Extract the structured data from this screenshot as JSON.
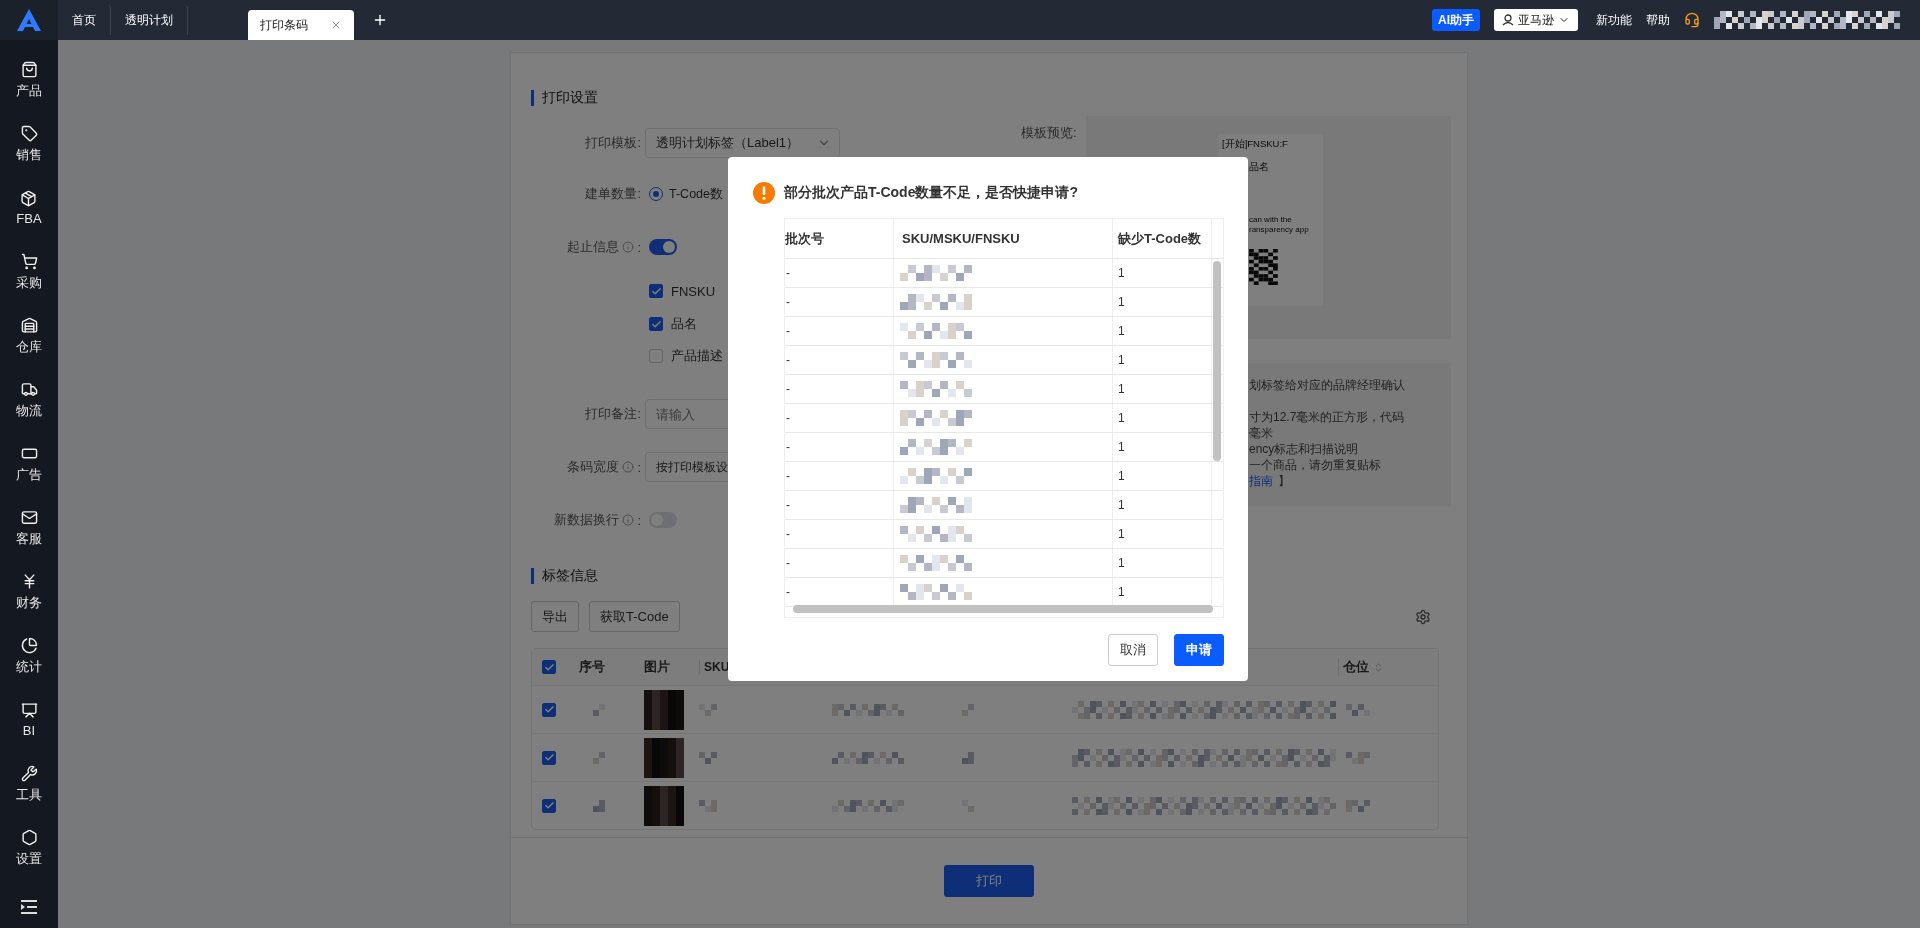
{
  "topbar": {
    "tabs": [
      {
        "label": "首页",
        "selected": false,
        "closable": false
      },
      {
        "label": "透明计划",
        "selected": false,
        "closable": false
      },
      {
        "label": "打印条码",
        "selected": true,
        "closable": true
      }
    ],
    "ai_button": "AI助手",
    "marketplace": "亚马逊",
    "links": [
      "新功能",
      "帮助"
    ]
  },
  "sidebar": {
    "items": [
      {
        "label": "产品"
      },
      {
        "label": "销售"
      },
      {
        "label": "FBA"
      },
      {
        "label": "采购"
      },
      {
        "label": "仓库"
      },
      {
        "label": "物流"
      },
      {
        "label": "广告"
      },
      {
        "label": "客服"
      },
      {
        "label": "财务"
      },
      {
        "label": "统计"
      },
      {
        "label": "BI"
      },
      {
        "label": "工具"
      },
      {
        "label": "设置"
      }
    ]
  },
  "print_settings": {
    "title": "打印设置",
    "template": {
      "label": "打印模板:",
      "value": "透明计划标签（Label1）"
    },
    "quantity": {
      "label": "建单数量:",
      "options": [
        {
          "label": "T-Code数",
          "selected": true
        }
      ]
    },
    "range_info": {
      "label": "起止信息",
      "colon": ":",
      "on": true
    },
    "fields": [
      {
        "label": "FNSKU",
        "checked": true
      },
      {
        "label": "品名",
        "checked": true
      },
      {
        "label": "产品描述",
        "checked": false
      }
    ],
    "remark": {
      "label": "打印备注:",
      "placeholder": "请输入"
    },
    "barcode_width": {
      "label": "条码宽度",
      "colon": ":",
      "value": "按打印模板设"
    },
    "new_line": {
      "label": "新数据换行",
      "colon": ":",
      "on": false
    },
    "preview": {
      "label": "模板预览:",
      "lines": [
        "[开始]FNSKU:F",
        "品名",
        "can with the",
        "ransparency app"
      ]
    },
    "notes": {
      "lines": [
        "划标签给对应的品牌经理确认",
        "寸为12.7毫米的正方形，代码",
        "毫米",
        "ency标志和扫描说明",
        "一个商品，请勿重复贴标"
      ],
      "link": "指南",
      "closing": "】"
    }
  },
  "label_info": {
    "title": "标签信息",
    "buttons": [
      "导出",
      "获取T-Code"
    ],
    "table": {
      "select_all": true,
      "columns": [
        "序号",
        "图片",
        "SKU",
        "仓位"
      ],
      "rows": [
        {
          "checked": true
        },
        {
          "checked": true
        },
        {
          "checked": true
        }
      ]
    }
  },
  "footer": {
    "print_button": "打印"
  },
  "dialog": {
    "title": "部分批次产品T-Code数量不足，是否快捷申请?",
    "columns": [
      "批次号",
      "SKU/MSKU/FNSKU",
      "缺少T-Code数"
    ],
    "rows": [
      {
        "batch": "-",
        "missing": "1"
      },
      {
        "batch": "-",
        "missing": "1"
      },
      {
        "batch": "-",
        "missing": "1"
      },
      {
        "batch": "-",
        "missing": "1"
      },
      {
        "batch": "-",
        "missing": "1"
      },
      {
        "batch": "-",
        "missing": "1"
      },
      {
        "batch": "-",
        "missing": "1"
      },
      {
        "batch": "-",
        "missing": "1"
      },
      {
        "batch": "-",
        "missing": "1"
      },
      {
        "batch": "-",
        "missing": "1"
      },
      {
        "batch": "-",
        "missing": "1"
      },
      {
        "batch": "-",
        "missing": "1"
      }
    ],
    "cancel": "取消",
    "apply": "申请"
  }
}
